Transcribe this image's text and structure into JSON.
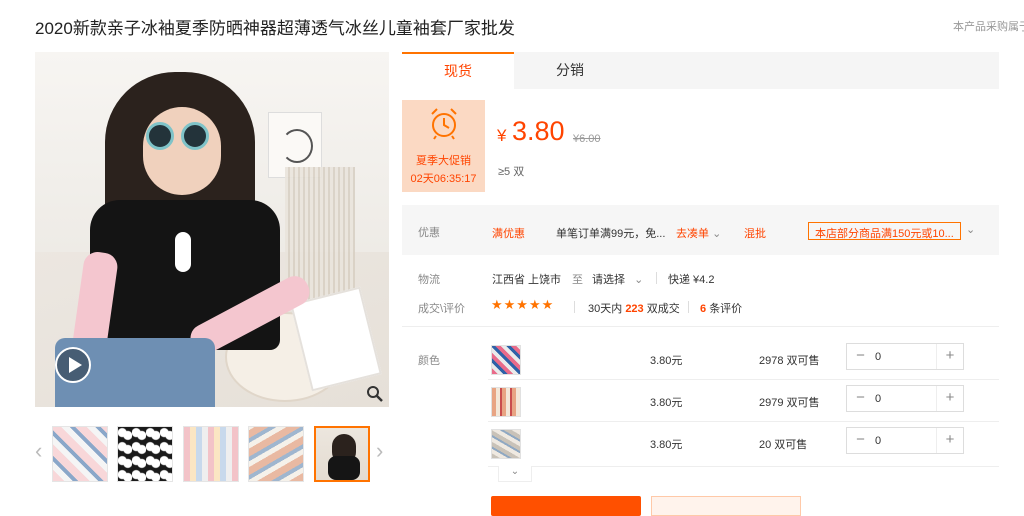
{
  "title": "2020新款亲子冰袖夏季防晒神器超薄透气冰丝儿童袖套厂家批发",
  "report_link": "本产品采购属于",
  "tabs": [
    {
      "label": "现货"
    },
    {
      "label": "分销"
    }
  ],
  "promo": {
    "label": "夏季大促销",
    "countdown": "02天06:35:17"
  },
  "price": {
    "currency": "¥",
    "value": "3.80",
    "original": "¥6.00",
    "min_order": "≥5 双"
  },
  "discount": {
    "label": "优惠",
    "tag1": "满优惠",
    "text1": "单笔订单满99元，免...",
    "link": "去凑单",
    "tag2": "混批",
    "coupon": "本店部分商品满150元或10..."
  },
  "logistics": {
    "label": "物流",
    "from": "江西省 上饶市",
    "to_word": "至",
    "select": "请选择",
    "express": "快递 ¥4.2"
  },
  "deals": {
    "label": "成交\\评价",
    "stars": "★★★★★",
    "prefix": "30天内",
    "count": "223",
    "suffix": "双成交",
    "reviews_count": "6",
    "reviews_suffix": "条评价"
  },
  "color_label": "颜色",
  "variants": [
    {
      "price": "3.80元",
      "stock": "2978 双可售",
      "qty": "0"
    },
    {
      "price": "3.80元",
      "stock": "2979 双可售",
      "qty": "0"
    },
    {
      "price": "3.80元",
      "stock": "20 双可售",
      "qty": "0"
    }
  ],
  "colors": {
    "accent": "#ff4400",
    "promo_bg": "#fbd9c3"
  }
}
